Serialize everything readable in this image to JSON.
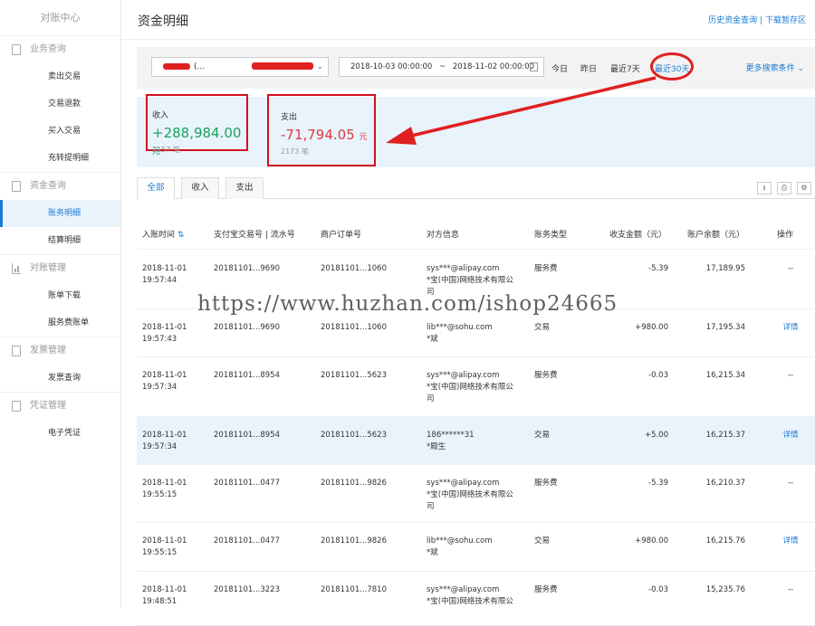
{
  "sidebar": {
    "title": "对账中心",
    "groups": [
      {
        "label": "业务查询",
        "icon": "document-icon",
        "items": [
          "卖出交易",
          "交易退款",
          "买入交易",
          "充转提明细"
        ]
      },
      {
        "label": "资金查询",
        "icon": "document-icon",
        "items": [
          "账务明细",
          "结算明细"
        ]
      },
      {
        "label": "对账管理",
        "icon": "bar-chart-icon",
        "items": [
          "账单下载",
          "服务费账单"
        ]
      },
      {
        "label": "发票管理",
        "icon": "invoice-icon",
        "items": [
          "发票查询"
        ]
      },
      {
        "label": "凭证管理",
        "icon": "voucher-icon",
        "items": [
          "电子凭证"
        ]
      }
    ],
    "active_item": "账务明细"
  },
  "header": {
    "title": "资金明细",
    "link_history": "历史资金查询",
    "separator": "|",
    "link_download": "下载暂存区"
  },
  "filter": {
    "account_select_value": "(...",
    "date_start": "2018-10-03 00:00:00",
    "date_sep": "~",
    "date_end": "2018-11-02 00:00:00",
    "quick_today": "今日",
    "quick_yesterday": "昨日",
    "quick_7days": "最近7天",
    "quick_30days": "最近30天",
    "more_conditions": "更多搜索条件"
  },
  "summary": {
    "income_label": "收入",
    "income_amount": "+288,984.00",
    "income_unit": "元",
    "income_count": "2157 笔",
    "expense_label": "支出",
    "expense_amount": "-71,794.05",
    "expense_unit": "元",
    "expense_count": "2173 笔"
  },
  "tabs": [
    "全部",
    "收入",
    "支出"
  ],
  "table": {
    "headers": [
      "入账时间",
      "支付宝交易号 | 流水号",
      "商户订单号",
      "对方信息",
      "账务类型",
      "收支金额（元）",
      "账户余额（元）",
      "操作"
    ],
    "rows": [
      {
        "date": "2018-11-01",
        "time": "19:57:44",
        "trade_no": "20181101...9690",
        "order_no": "20181101...1060",
        "party1": "sys***@alipay.com",
        "party2": "*宝(中国)网络技术有限公",
        "party3": "司",
        "type": "服务费",
        "amount": "-5.39",
        "balance": "17,189.95",
        "op": "--"
      },
      {
        "date": "2018-11-01",
        "time": "19:57:43",
        "trade_no": "20181101...9690",
        "order_no": "20181101...1060",
        "party1": "lib***@sohu.com",
        "party2": "*斌",
        "party3": "",
        "type": "交易",
        "amount": "+980.00",
        "balance": "17,195.34",
        "op": "详情"
      },
      {
        "date": "2018-11-01",
        "time": "19:57:34",
        "trade_no": "20181101...8954",
        "order_no": "20181101...5623",
        "party1": "sys***@alipay.com",
        "party2": "*宝(中国)网络技术有限公",
        "party3": "司",
        "type": "服务费",
        "amount": "-0.03",
        "balance": "16,215.34",
        "op": "--"
      },
      {
        "date": "2018-11-01",
        "time": "19:57:34",
        "trade_no": "20181101...8954",
        "order_no": "20181101...5623",
        "party1": "186******31",
        "party2": "*殿生",
        "party3": "",
        "type": "交易",
        "amount": "+5.00",
        "balance": "16,215.37",
        "op": "详情"
      },
      {
        "date": "2018-11-01",
        "time": "19:55:15",
        "trade_no": "20181101...0477",
        "order_no": "20181101...9826",
        "party1": "sys***@alipay.com",
        "party2": "*宝(中国)网络技术有限公",
        "party3": "司",
        "type": "服务费",
        "amount": "-5.39",
        "balance": "16,210.37",
        "op": "--"
      },
      {
        "date": "2018-11-01",
        "time": "19:55:15",
        "trade_no": "20181101...0477",
        "order_no": "20181101...9826",
        "party1": "lib***@sohu.com",
        "party2": "*斌",
        "party3": "",
        "type": "交易",
        "amount": "+980.00",
        "balance": "16,215.76",
        "op": "详情"
      },
      {
        "date": "2018-11-01",
        "time": "19:48:51",
        "trade_no": "20181101...3223",
        "order_no": "20181101...7810",
        "party1": "sys***@alipay.com",
        "party2": "*宝(中国)网络技术有限公",
        "party3": "",
        "type": "服务费",
        "amount": "-0.03",
        "balance": "15,235.76",
        "op": "--"
      }
    ]
  },
  "watermark": "https://www.huzhan.com/ishop24665",
  "colors": {
    "accent": "#1a7bd6",
    "income": "#1aa260",
    "expense": "#e0393e",
    "annotation": "#e02020"
  }
}
